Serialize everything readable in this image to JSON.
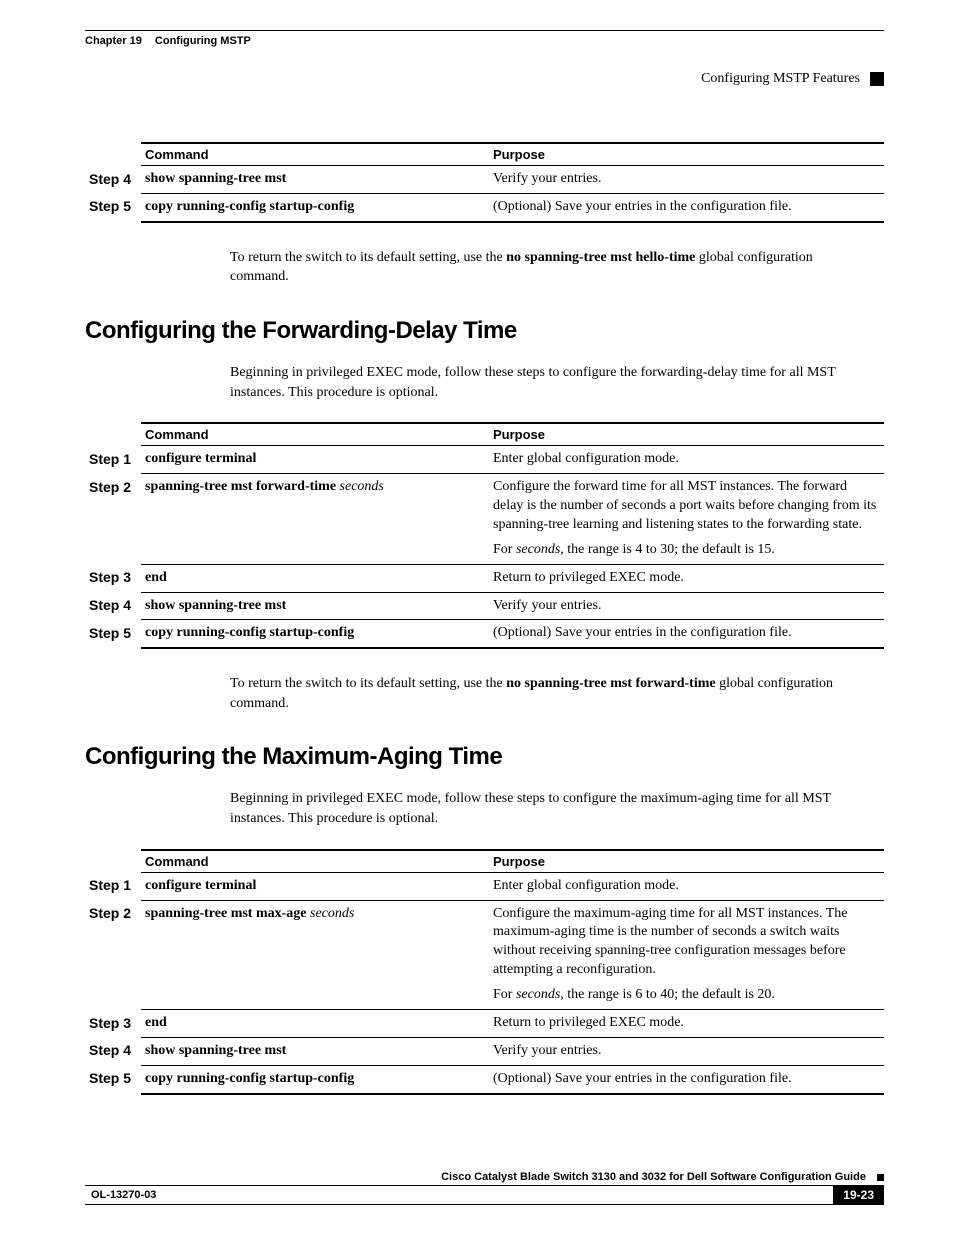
{
  "header": {
    "chapter_label": "Chapter 19",
    "chapter_title": "Configuring MSTP",
    "section_right": "Configuring MSTP Features"
  },
  "table1": {
    "head_command": "Command",
    "head_purpose": "Purpose",
    "rows": [
      {
        "step": "Step 4",
        "cmd_b": "show spanning-tree mst",
        "cmd_i": "",
        "purpose": "Verify your entries."
      },
      {
        "step": "Step 5",
        "cmd_b": "copy running-config startup-config",
        "cmd_i": "",
        "purpose": "(Optional) Save your entries in the configuration file."
      }
    ]
  },
  "para1_a": "To return the switch to its default setting, use the ",
  "para1_b": "no spanning-tree mst hello-time",
  "para1_c": " global configuration command.",
  "section2": "Configuring the Forwarding-Delay Time",
  "para2": "Beginning in privileged EXEC mode, follow these steps to configure the forwarding-delay time for all MST instances. This procedure is optional.",
  "table2": {
    "head_command": "Command",
    "head_purpose": "Purpose",
    "rows": [
      {
        "step": "Step 1",
        "cmd_b": "configure terminal",
        "cmd_i": "",
        "purpose": "Enter global configuration mode."
      },
      {
        "step": "Step 2",
        "cmd_b": "spanning-tree mst forward-time",
        "cmd_i": " seconds",
        "purpose": "Configure the forward time for all MST instances. The forward delay is the number of seconds a port waits before changing from its spanning-tree learning and listening states to the forwarding state.",
        "purpose2_a": "For ",
        "purpose2_i": "seconds",
        "purpose2_b": ", the range is 4 to 30; the default is 15."
      },
      {
        "step": "Step 3",
        "cmd_b": "end",
        "cmd_i": "",
        "purpose": "Return to privileged EXEC mode."
      },
      {
        "step": "Step 4",
        "cmd_b": "show spanning-tree mst",
        "cmd_i": "",
        "purpose": "Verify your entries."
      },
      {
        "step": "Step 5",
        "cmd_b": "copy running-config startup-config",
        "cmd_i": "",
        "purpose": "(Optional) Save your entries in the configuration file."
      }
    ]
  },
  "para3_a": "To return the switch to its default setting, use the ",
  "para3_b": "no spanning-tree mst forward-time",
  "para3_c": " global configuration command.",
  "section3": "Configuring the Maximum-Aging Time",
  "para4": "Beginning in privileged EXEC mode, follow these steps to configure the maximum-aging time for all MST instances. This procedure is optional.",
  "table3": {
    "head_command": "Command",
    "head_purpose": "Purpose",
    "rows": [
      {
        "step": "Step 1",
        "cmd_b": "configure terminal",
        "cmd_i": "",
        "purpose": "Enter global configuration mode."
      },
      {
        "step": "Step 2",
        "cmd_b": "spanning-tree mst max-age",
        "cmd_i": " seconds",
        "purpose": "Configure the maximum-aging time for all MST instances. The maximum-aging time is the number of seconds a switch waits without receiving spanning-tree configuration messages before attempting a reconfiguration.",
        "purpose2_a": "For ",
        "purpose2_i": "seconds",
        "purpose2_b": ", the range is 6 to 40; the default is 20."
      },
      {
        "step": "Step 3",
        "cmd_b": "end",
        "cmd_i": "",
        "purpose": "Return to privileged EXEC mode."
      },
      {
        "step": "Step 4",
        "cmd_b": "show spanning-tree mst",
        "cmd_i": "",
        "purpose": "Verify your entries."
      },
      {
        "step": "Step 5",
        "cmd_b": "copy running-config startup-config",
        "cmd_i": "",
        "purpose": "(Optional) Save your entries in the configuration file."
      }
    ]
  },
  "footer": {
    "book": "Cisco Catalyst Blade Switch 3130 and 3032 for Dell Software Configuration Guide",
    "doc": "OL-13270-03",
    "page": "19-23"
  }
}
